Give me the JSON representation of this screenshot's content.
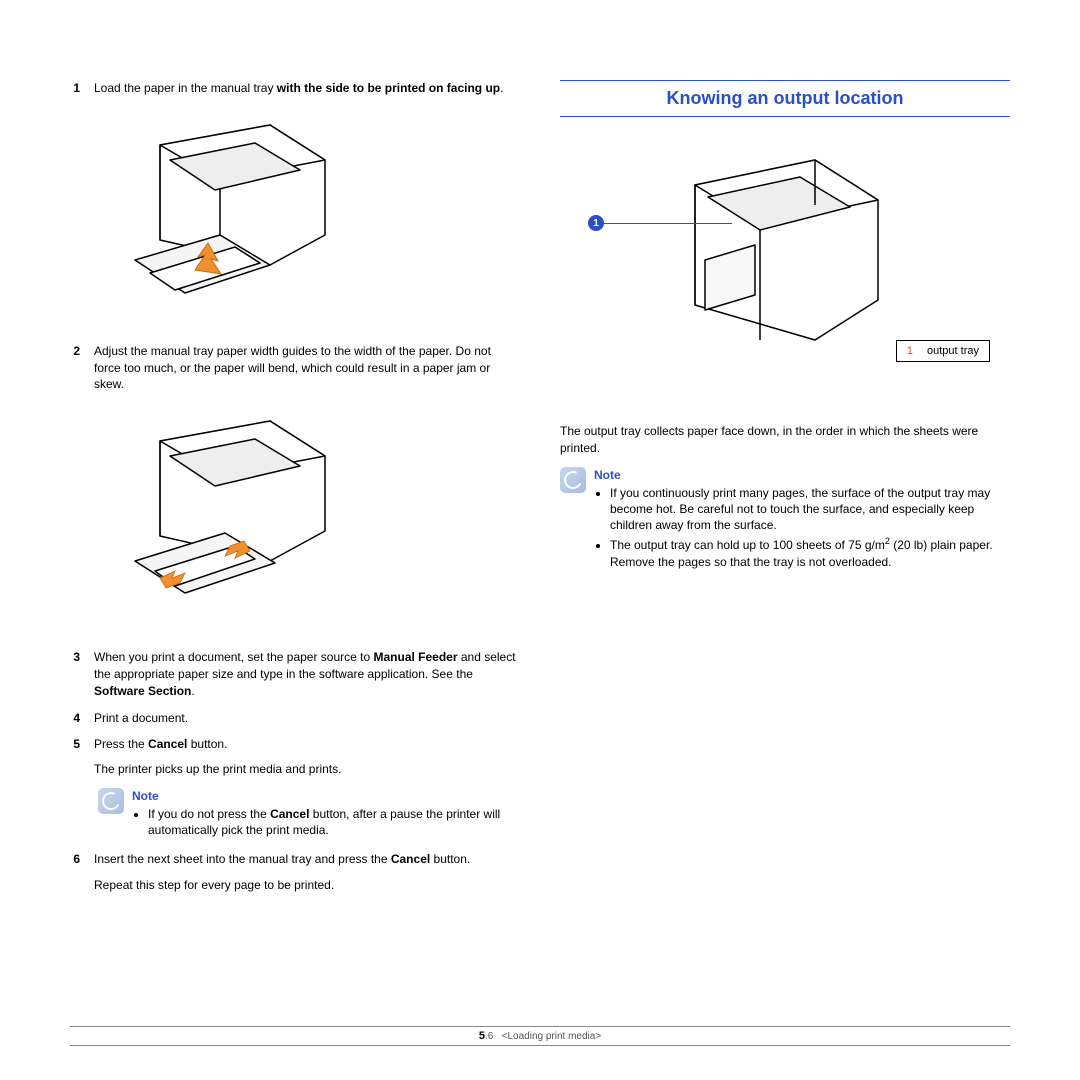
{
  "left": {
    "steps": {
      "s1": {
        "num": "1",
        "pre": "Load the paper in the manual tray ",
        "bold": "with the side to be printed on facing up",
        "post": "."
      },
      "s2": {
        "num": "2",
        "text": "Adjust the manual tray paper width guides to the width of the paper. Do not force too much, or the paper will bend, which could result in a paper jam or skew."
      },
      "s3": {
        "num": "3",
        "pre": "When you print a document, set the paper source to ",
        "b1": "Manual Feeder",
        "mid": " and select the appropriate paper size and type in the software application. See the ",
        "b2": "Software Section",
        "post": "."
      },
      "s4": {
        "num": "4",
        "text": "Print a document."
      },
      "s5": {
        "num": "5",
        "pre": "Press the ",
        "b1": "Cancel",
        "post": " button.",
        "extra": "The printer picks up the print media and prints."
      },
      "s6": {
        "num": "6",
        "pre": "Insert the next sheet into the manual tray and press the ",
        "b1": "Cancel",
        "post": " button.",
        "extra": "Repeat this step for every page to be printed."
      }
    },
    "note": {
      "title": "Note",
      "item_pre": "If you do not press the ",
      "item_b": "Cancel",
      "item_post": " button, after a pause the printer will automatically pick the print media."
    }
  },
  "right": {
    "heading": "Knowing an output location",
    "callout_num": "1",
    "legend_num": "1",
    "legend_label": "output tray",
    "para": "The output tray collects paper face down, in the order in which the sheets were printed.",
    "note": {
      "title": "Note",
      "i1": "If you continuously print many pages, the surface of the output tray may become hot. Be careful not to touch the surface, and especially keep children away from the surface.",
      "i2_pre": "The output tray can hold up to 100 sheets of 75 g/m",
      "i2_sup": "2",
      "i2_post": " (20 lb) plain paper. Remove the pages so that the tray is not overloaded."
    }
  },
  "footer": {
    "page_major": "5",
    "page_minor": ".6",
    "chapter": "<Loading print media>"
  }
}
